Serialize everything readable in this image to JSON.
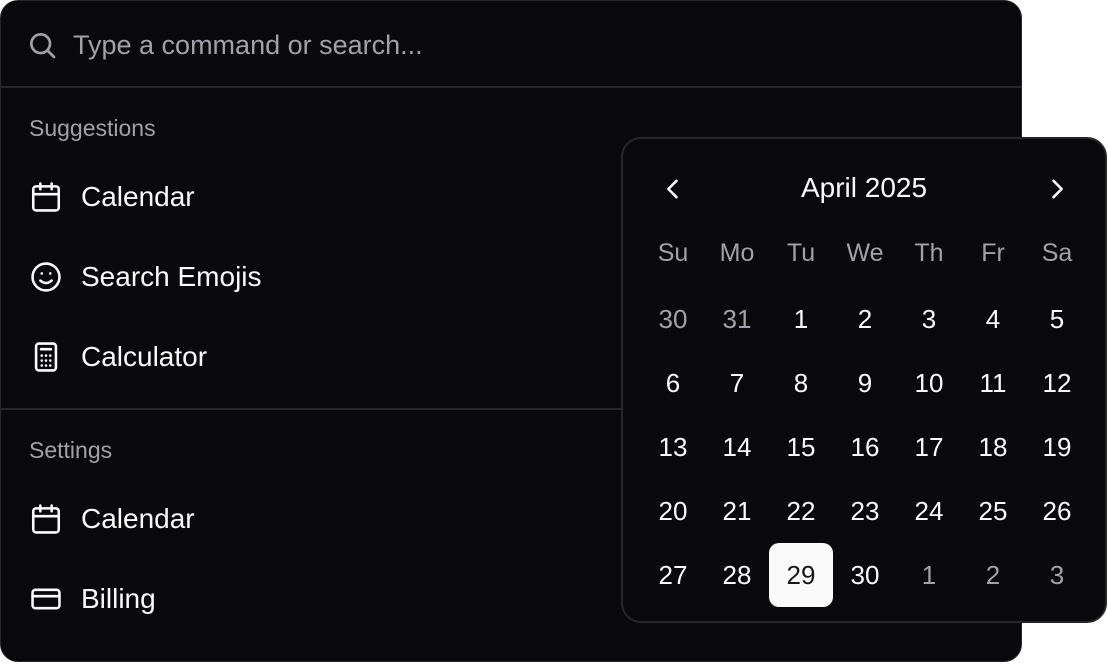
{
  "search": {
    "placeholder": "Type a command or search..."
  },
  "groups": [
    {
      "heading": "Suggestions",
      "items": [
        {
          "label": "Calendar",
          "icon": "calendar-icon"
        },
        {
          "label": "Search Emojis",
          "icon": "smile-icon"
        },
        {
          "label": "Calculator",
          "icon": "calculator-icon"
        }
      ]
    },
    {
      "heading": "Settings",
      "items": [
        {
          "label": "Calendar",
          "icon": "calendar-icon"
        },
        {
          "label": "Billing",
          "icon": "credit-card-icon"
        }
      ]
    }
  ],
  "calendar": {
    "title": "April 2025",
    "weekdays": [
      "Su",
      "Mo",
      "Tu",
      "We",
      "Th",
      "Fr",
      "Sa"
    ],
    "weeks": [
      [
        "30",
        "31",
        "1",
        "2",
        "3",
        "4",
        "5"
      ],
      [
        "6",
        "7",
        "8",
        "9",
        "10",
        "11",
        "12"
      ],
      [
        "13",
        "14",
        "15",
        "16",
        "17",
        "18",
        "19"
      ],
      [
        "20",
        "21",
        "22",
        "23",
        "24",
        "25",
        "26"
      ],
      [
        "27",
        "28",
        "29",
        "30",
        "1",
        "2",
        "3"
      ]
    ],
    "outside_days": [
      [
        0,
        0
      ],
      [
        0,
        1
      ],
      [
        4,
        4
      ],
      [
        4,
        5
      ],
      [
        4,
        6
      ]
    ],
    "selected": [
      4,
      2
    ]
  },
  "colors": {
    "background": "#09090b",
    "border": "#27272a",
    "text": "#fafafa",
    "muted": "#a1a1aa",
    "selected_bg": "#fafafa"
  }
}
